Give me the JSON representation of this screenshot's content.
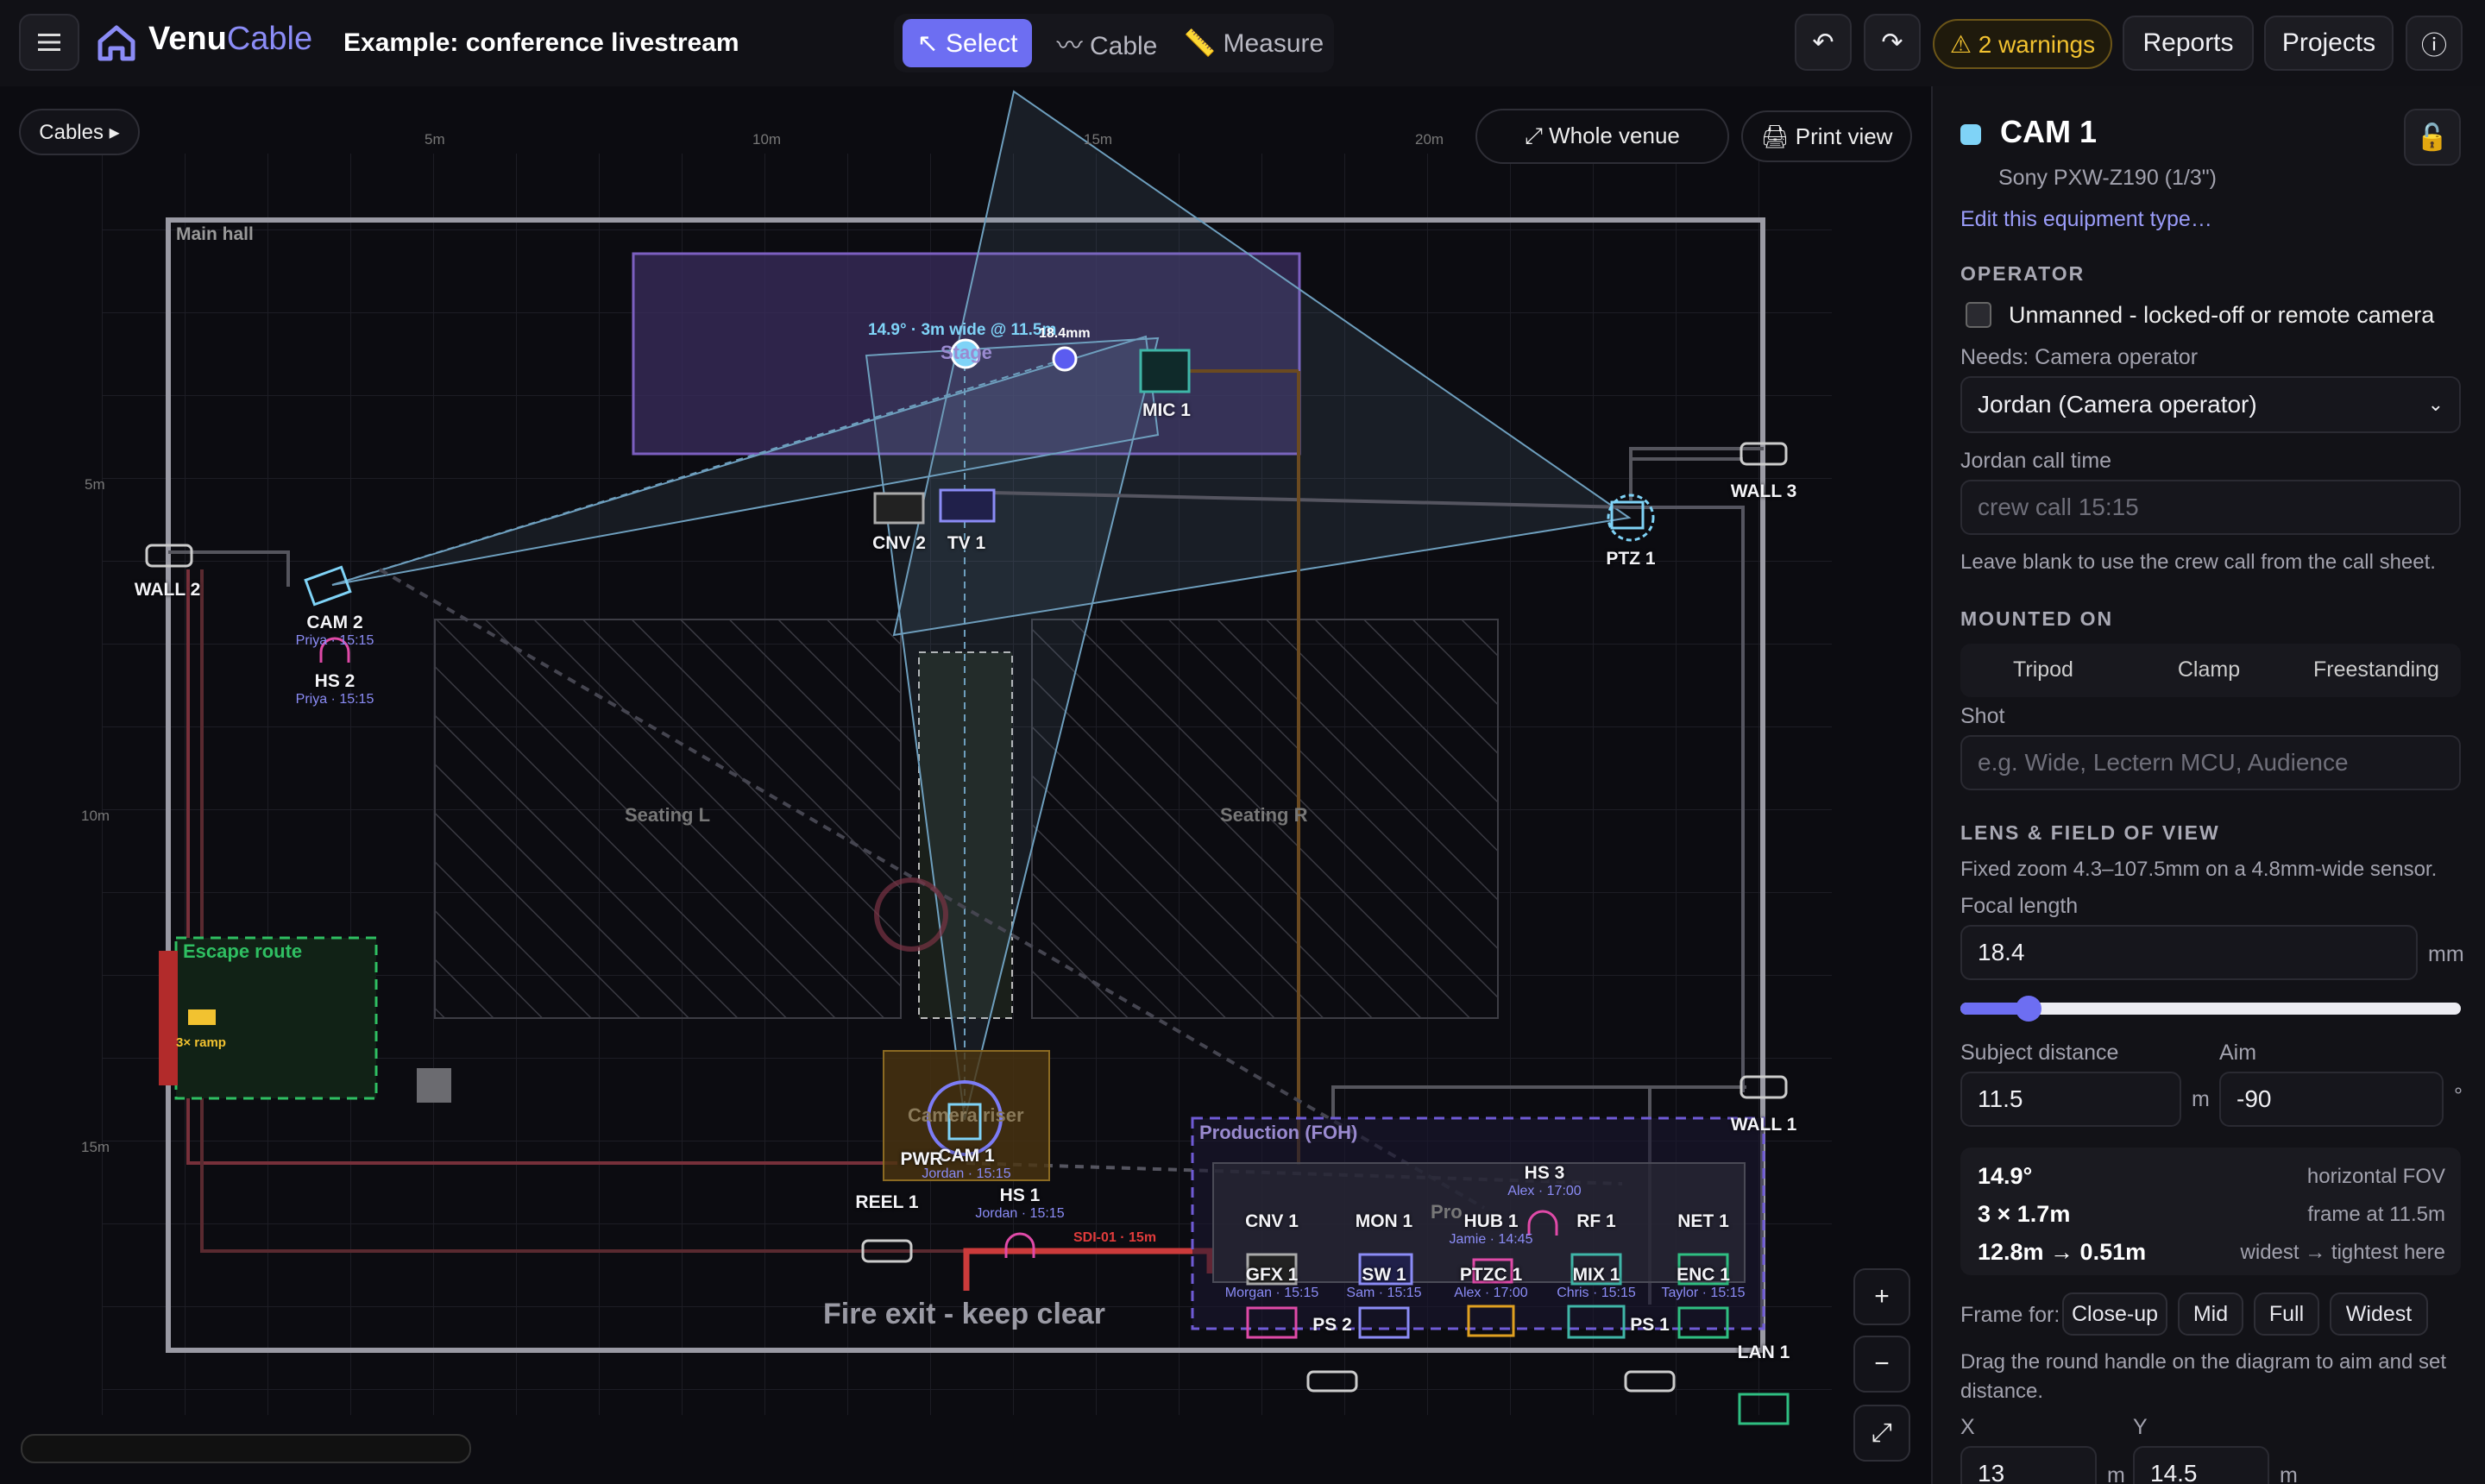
{
  "app": {
    "name_a": "Venu",
    "name_b": "Cable",
    "project": "Example: conference livestream"
  },
  "toolbar": {
    "menu_icon": "hamburger-icon",
    "modes": [
      {
        "label": "↖ Select"
      },
      {
        "label": "〰 Cable"
      },
      {
        "label": "📏 Measure"
      }
    ],
    "undo": "↶",
    "redo": "↷",
    "warnings": "⚠ 2 warnings",
    "reports": "Reports",
    "projects": "Projects",
    "info": "ⓘ"
  },
  "canvas": {
    "cables_btn": "Cables ▸",
    "view_select": "⤢ Whole venue",
    "print": "🖨 Print view",
    "ruler_x": [
      "5m",
      "10m",
      "15m",
      "20m"
    ],
    "ruler_y": [
      "5m",
      "10m",
      "15m"
    ],
    "zones": {
      "hall": "Main hall",
      "stage": "Stage",
      "seat_l": "Seating L",
      "seat_r": "Seating R",
      "escape": "Escape route",
      "ramp": "3× ramp",
      "riser": "Camera riser",
      "production": "Production (FOH)",
      "prod2": "Pro",
      "fire": "Fire exit - keep clear"
    },
    "fov_text": "14.9° · 3m wide @ 11.5m",
    "focal_tag": "18.4mm",
    "cable_tag": "SDI-01 · 15m",
    "devices": [
      {
        "label": "MIC 1",
        "sub": ""
      },
      {
        "label": "CNV 2",
        "sub": ""
      },
      {
        "label": "TV 1",
        "sub": ""
      },
      {
        "label": "PTZ 1",
        "sub": ""
      },
      {
        "label": "WALL 2",
        "sub": ""
      },
      {
        "label": "WALL 3",
        "sub": ""
      },
      {
        "label": "WALL 1",
        "sub": ""
      },
      {
        "label": "CAM 2",
        "sub": "Priya · 15:15"
      },
      {
        "label": "HS 2",
        "sub": "Priya · 15:15"
      },
      {
        "label": "CAM 1",
        "sub": "Jordan · 15:15"
      },
      {
        "label": "HS 1",
        "sub": "Jordan · 15:15"
      },
      {
        "label": "REEL 1",
        "sub": ""
      },
      {
        "label": "HS 3",
        "sub": "Alex · 17:00"
      },
      {
        "label": "CNV 1",
        "sub": ""
      },
      {
        "label": "MON 1",
        "sub": ""
      },
      {
        "label": "HUB 1",
        "sub": "Jamie · 14:45"
      },
      {
        "label": "RF 1",
        "sub": ""
      },
      {
        "label": "NET 1",
        "sub": ""
      },
      {
        "label": "GFX 1",
        "sub": "Morgan · 15:15"
      },
      {
        "label": "SW 1",
        "sub": "Sam · 15:15"
      },
      {
        "label": "PTZC 1",
        "sub": "Alex · 17:00"
      },
      {
        "label": "MIX 1",
        "sub": "Chris · 15:15"
      },
      {
        "label": "ENC 1",
        "sub": "Taylor · 15:15"
      },
      {
        "label": "PS 2",
        "sub": ""
      },
      {
        "label": "PS 1",
        "sub": ""
      },
      {
        "label": "LAN 1",
        "sub": ""
      },
      {
        "label": "PWR",
        "sub": ""
      }
    ],
    "zoom_in": "+",
    "zoom_out": "−",
    "fit": "⤢"
  },
  "inspector": {
    "title": "CAM 1",
    "subtitle": "Sony PXW-Z190 (1/3\")",
    "edit_link": "Edit this equipment type…",
    "color": "#7fd3f7",
    "operator": {
      "section": "OPERATOR",
      "unmanned": "Unmanned - locked-off or remote camera",
      "needs": "Needs: Camera operator",
      "selected": "Jordan (Camera operator)",
      "calltime_label": "Jordan call time",
      "calltime_ph": "crew call 15:15",
      "hint": "Leave blank to use the crew call from the call sheet."
    },
    "mount": {
      "section": "MOUNTED ON",
      "options": [
        "Tripod",
        "Clamp",
        "Freestanding"
      ],
      "shot_label": "Shot",
      "shot_ph": "e.g. Wide, Lectern MCU, Audience"
    },
    "lens": {
      "section": "LENS & FIELD OF VIEW",
      "desc": "Fixed zoom 4.3–107.5mm on a 4.8mm-wide sensor.",
      "focal_label": "Focal length",
      "focal": "18.4",
      "unit_mm": "mm",
      "focal_fraction": 0.137,
      "dist_label": "Subject distance",
      "dist": "11.5",
      "unit_m": "m",
      "aim_label": "Aim",
      "aim": "-90",
      "unit_deg": "°",
      "stats": [
        {
          "v": "14.9°",
          "k": "horizontal FOV"
        },
        {
          "v": "3 × 1.7m",
          "k": "frame at 11.5m"
        },
        {
          "v": "12.8m → 0.51m",
          "k": "widest → tightest here"
        }
      ],
      "frame_for": "Frame for:",
      "frame_opts": [
        "Close-up",
        "Mid",
        "Full",
        "Widest"
      ],
      "drag_hint": "Drag the round handle on the diagram to aim and set distance.",
      "x_label": "X",
      "x": "13",
      "y_label": "Y",
      "y": "14.5"
    },
    "lock_icon": "🔓"
  }
}
